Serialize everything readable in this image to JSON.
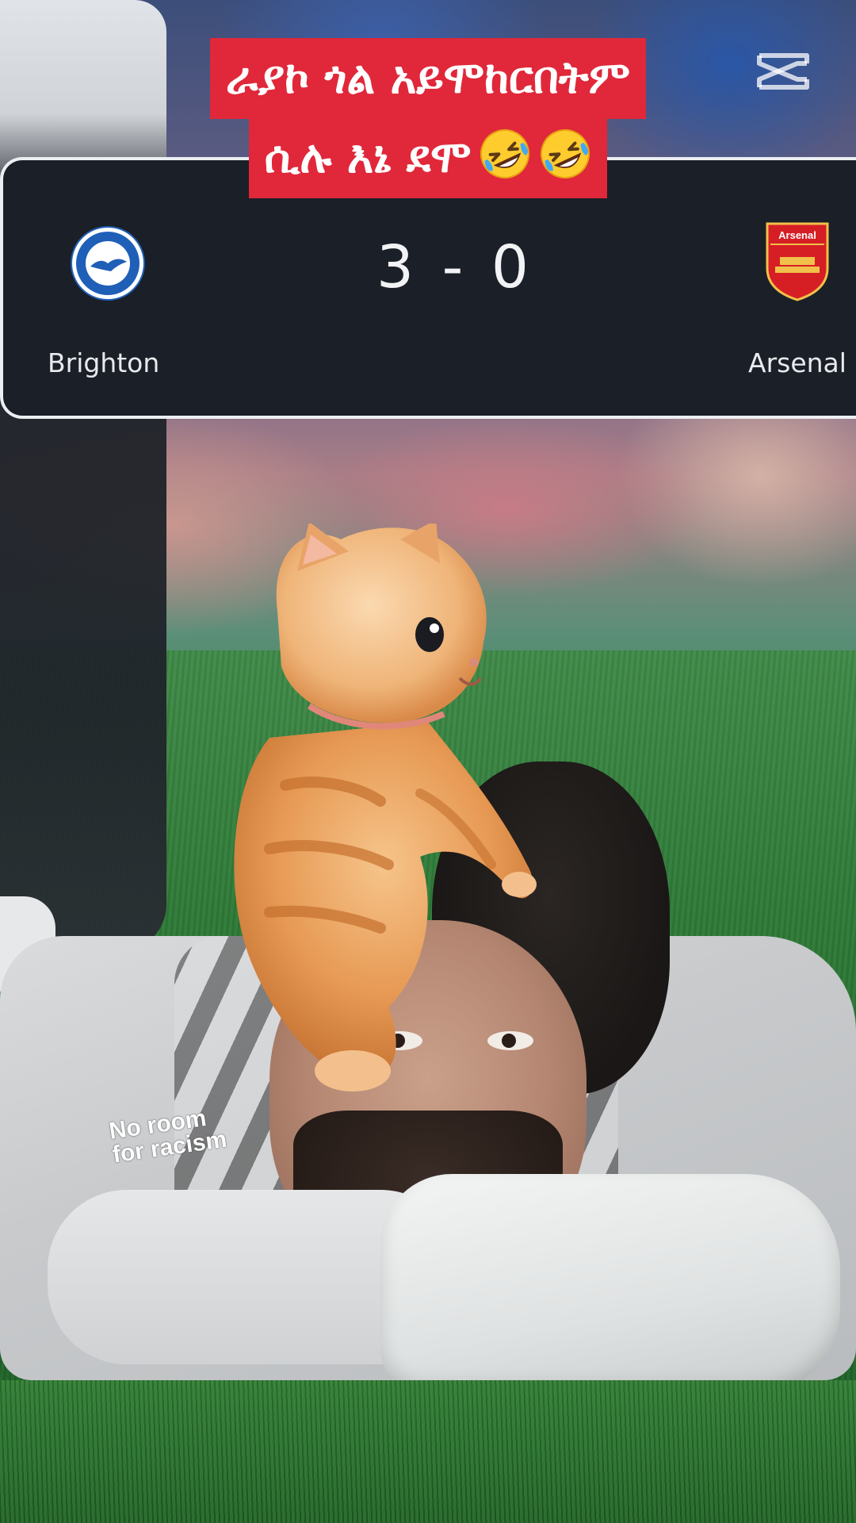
{
  "caption": {
    "line1": "ራያኮ ጎል አይሞከርበትም",
    "line2": "ሲሉ እኔ ደሞ",
    "emojis": [
      "rolling-on-floor-laughing",
      "rolling-on-floor-laughing"
    ],
    "background_color": "#e0283a",
    "text_color": "#ffffff"
  },
  "watermark": {
    "icon": "capcut-logo-icon"
  },
  "score_card": {
    "home_team": "Brighton",
    "away_team": "Arsenal",
    "score": "3 - 0",
    "away_crest_text": "Arsenal",
    "background_color": "#1b1f27",
    "border_color": "#eceff2"
  },
  "photo": {
    "patch_text": "No room for racism"
  }
}
